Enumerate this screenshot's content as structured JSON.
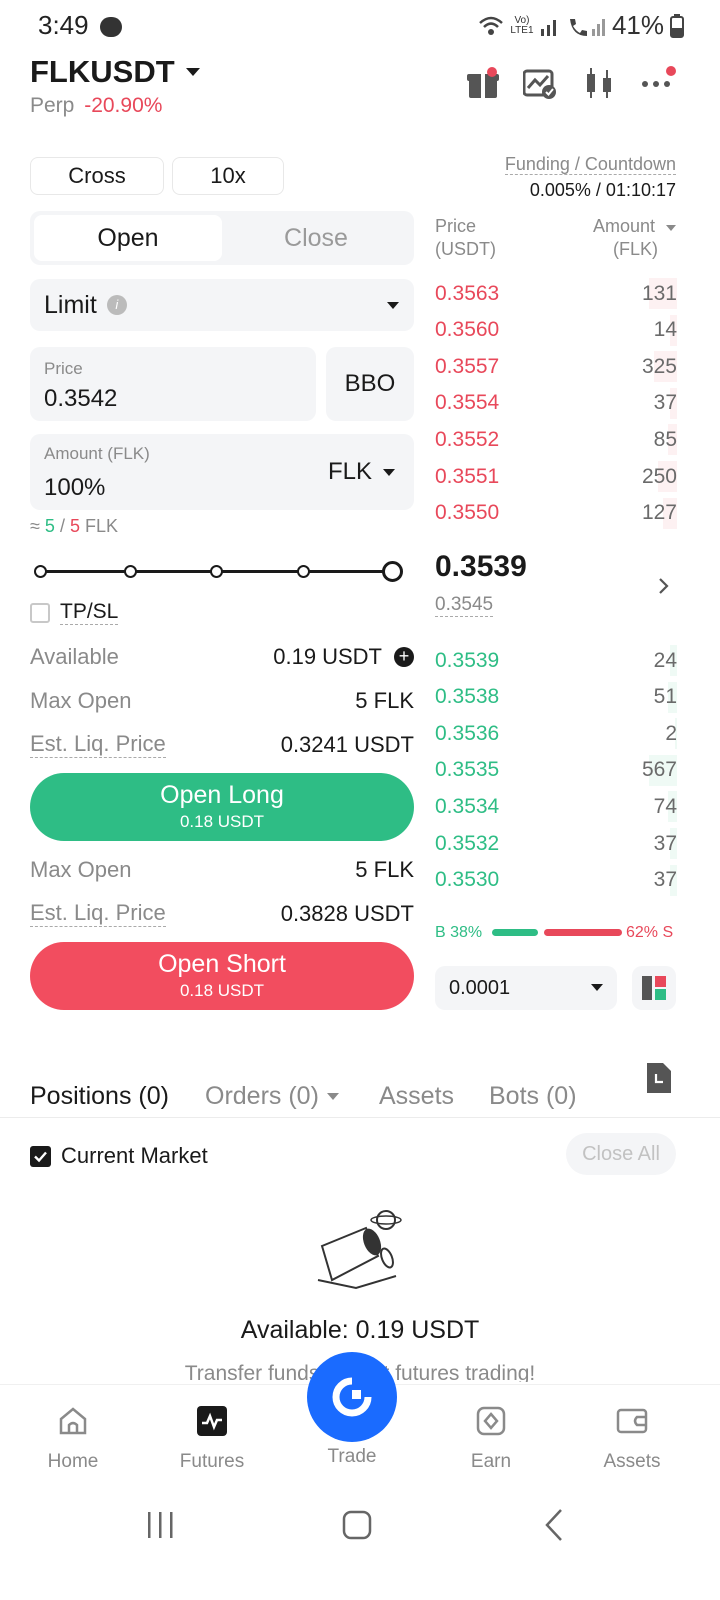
{
  "status_bar": {
    "time": "3:49",
    "battery": "41%",
    "network": "Vo) LTE1"
  },
  "header": {
    "symbol": "FLKUSDT",
    "type_label": "Perp",
    "change": "-20.90%"
  },
  "controls": {
    "margin_mode": "Cross",
    "leverage": "10x"
  },
  "funding": {
    "label": "Funding / Countdown",
    "value": "0.005% / 01:10:17"
  },
  "order_tabs": {
    "open": "Open",
    "close": "Close"
  },
  "order_type": "Limit",
  "price_field": {
    "label": "Price",
    "value": "0.3542",
    "bbo": "BBO"
  },
  "amount_field": {
    "label": "Amount (FLK)",
    "value": "100%",
    "unit": "FLK"
  },
  "approx": {
    "prefix": "≈",
    "left": "5",
    "sep": "/",
    "right": "5",
    "unit": "FLK"
  },
  "slider": {
    "level_percent": 100
  },
  "tpsl_label": "TP/SL",
  "available": {
    "label": "Available",
    "value": "0.19",
    "unit": "USDT"
  },
  "long": {
    "max_open_label": "Max Open",
    "max_open_value": "5 FLK",
    "liq_label": "Est. Liq. Price",
    "liq_value": "0.3241 USDT",
    "button_label": "Open Long",
    "button_sub": "0.18 USDT"
  },
  "short": {
    "max_open_label": "Max Open",
    "max_open_value": "5 FLK",
    "liq_label": "Est. Liq. Price",
    "liq_value": "0.3828 USDT",
    "button_label": "Open Short",
    "button_sub": "0.18 USDT"
  },
  "orderbook": {
    "price_header": "Price",
    "price_unit": "(USDT)",
    "amount_header": "Amount",
    "amount_unit": "(FLK)",
    "asks": [
      {
        "price": "0.3563",
        "amount": "131",
        "depth": 0.12
      },
      {
        "price": "0.3560",
        "amount": "14",
        "depth": 0.03
      },
      {
        "price": "0.3557",
        "amount": "325",
        "depth": 0.1
      },
      {
        "price": "0.3554",
        "amount": "37",
        "depth": 0.03
      },
      {
        "price": "0.3552",
        "amount": "85",
        "depth": 0.04
      },
      {
        "price": "0.3551",
        "amount": "250",
        "depth": 0.08
      },
      {
        "price": "0.3550",
        "amount": "127",
        "depth": 0.06
      }
    ],
    "last_price": "0.3539",
    "mark_price": "0.3545",
    "bids": [
      {
        "price": "0.3539",
        "amount": "24",
        "depth": 0.03
      },
      {
        "price": "0.3538",
        "amount": "51",
        "depth": 0.04
      },
      {
        "price": "0.3536",
        "amount": "2",
        "depth": 0.01
      },
      {
        "price": "0.3535",
        "amount": "567",
        "depth": 0.12
      },
      {
        "price": "0.3534",
        "amount": "74",
        "depth": 0.04
      },
      {
        "price": "0.3532",
        "amount": "37",
        "depth": 0.03
      },
      {
        "price": "0.3530",
        "amount": "37",
        "depth": 0.03
      }
    ],
    "buy_ratio_label": "B 38%",
    "sell_ratio_label": "62% S",
    "buy_ratio": 0.38,
    "precision": "0.0001"
  },
  "bottom_tabs": {
    "positions": "Positions (0)",
    "orders": "Orders (0)",
    "assets": "Assets",
    "bots": "Bots (0)"
  },
  "current_market": {
    "label": "Current Market",
    "close_all": "Close All"
  },
  "empty_state": {
    "available": "Available: 0.19 USDT",
    "hint": "Transfer funds to start futures trading!"
  },
  "nav": {
    "home": "Home",
    "futures": "Futures",
    "trade": "Trade",
    "earn": "Earn",
    "assets": "Assets"
  },
  "colors": {
    "green": "#2ebd85",
    "red": "#e8485a",
    "brand_blue": "#1a6bff"
  }
}
